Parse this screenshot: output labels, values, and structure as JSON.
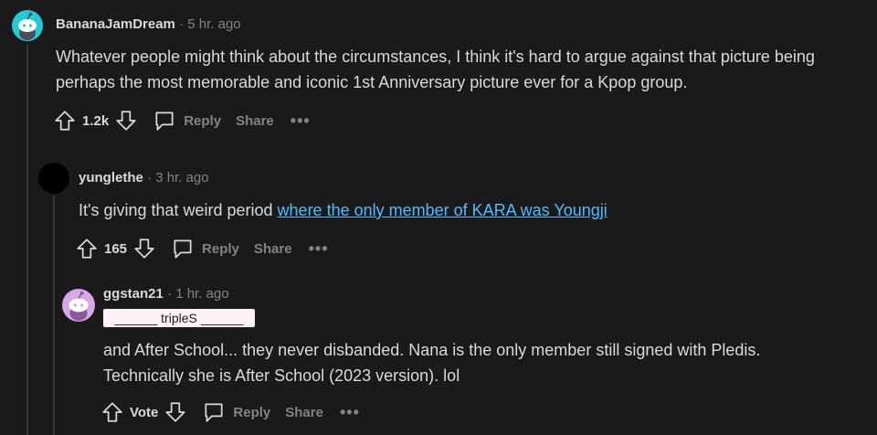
{
  "comments": [
    {
      "username": "BananaJamDream",
      "time": "5 hr. ago",
      "text": "Whatever people might think about the circumstances, I think it's hard to argue against that picture being perhaps the most memorable and iconic 1st Anniversary picture ever for a Kpop group.",
      "votes": "1.2k",
      "reply_label": "Reply",
      "share_label": "Share",
      "more_label": "•••",
      "avatar_color": "#24c9d6"
    },
    {
      "username": "yunglethe",
      "time": "3 hr. ago",
      "text_prefix": "It's giving that weird period ",
      "link_text": "where the only member of KARA was Youngji",
      "votes": "165",
      "reply_label": "Reply",
      "share_label": "Share",
      "more_label": "•••",
      "avatar_color": "#000000"
    },
    {
      "username": "ggstan21",
      "time": "1 hr. ago",
      "flair": "______ tripleS ______",
      "text_line1": "and After School... they never disbanded. Nana is the only member still signed with Pledis.",
      "text_line2": "Technically she is After School (2023 version). lol",
      "votes": "Vote",
      "reply_label": "Reply",
      "share_label": "Share",
      "more_label": "•••",
      "avatar_color": "#d9a6e8"
    }
  ],
  "separator": "·",
  "colors": {
    "background": "#1a1a1b",
    "text": "#d7dadc",
    "muted": "#818384",
    "link": "#4fbcff"
  }
}
